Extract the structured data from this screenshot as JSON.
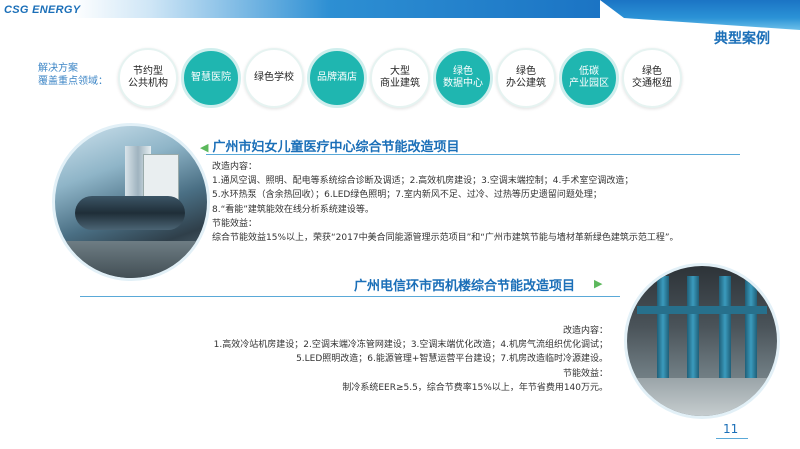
{
  "header": {
    "logo_text": "CSG ENERGY",
    "section_title": "典型案例"
  },
  "solutions": {
    "label_line1": "解决方案",
    "label_line2": "覆盖重点领域：",
    "items": [
      {
        "line1": "节约型",
        "line2": "公共机构",
        "style": "light"
      },
      {
        "line1": "智慧医院",
        "line2": "",
        "style": "teal"
      },
      {
        "line1": "绿色学校",
        "line2": "",
        "style": "light"
      },
      {
        "line1": "品牌酒店",
        "line2": "",
        "style": "teal"
      },
      {
        "line1": "大型",
        "line2": "商业建筑",
        "style": "light"
      },
      {
        "line1": "绿色",
        "line2": "数据中心",
        "style": "teal"
      },
      {
        "line1": "绿色",
        "line2": "办公建筑",
        "style": "light"
      },
      {
        "line1": "低碳",
        "line2": "产业园区",
        "style": "teal"
      },
      {
        "line1": "绿色",
        "line2": "交通枢纽",
        "style": "light"
      }
    ]
  },
  "project1": {
    "arrow": "◀",
    "title": "广州市妇女儿童医疗中心综合节能改造项目",
    "lines": [
      "改造内容：",
      "1.通风空调、照明、配电等系统综合诊断及调适；2.高效机房建设；3.空调末端控制；4.手术室空调改造；",
      "5.水环热泵（含余热回收）；6.LED绿色照明；7.室内新风不足、过冷、过热等历史遗留问题处理；",
      "8.“看能”建筑能效在线分析系统建设等。",
      "节能效益：",
      "综合节能效益15%以上，荣获“2017中美合同能源管理示范项目”和“广州市建筑节能与墙材革新绿色建筑示范工程”。"
    ]
  },
  "project2": {
    "arrow": "▶",
    "title": "广州电信环市西机楼综合节能改造项目",
    "lines": [
      "改造内容：",
      "1.高效冷站机房建设；2.空调末端冷冻管网建设；3.空调末端优化改造；4.机房气流组织优化调试；",
      "5.LED照明改造；6.能源管理+智慧运营平台建设；7.机房改造临时冷源建设。",
      "节能效益：",
      "制冷系统EER≥5.5，综合节费率15%以上，年节省费用140万元。"
    ]
  },
  "footer": {
    "page_number": "11"
  }
}
